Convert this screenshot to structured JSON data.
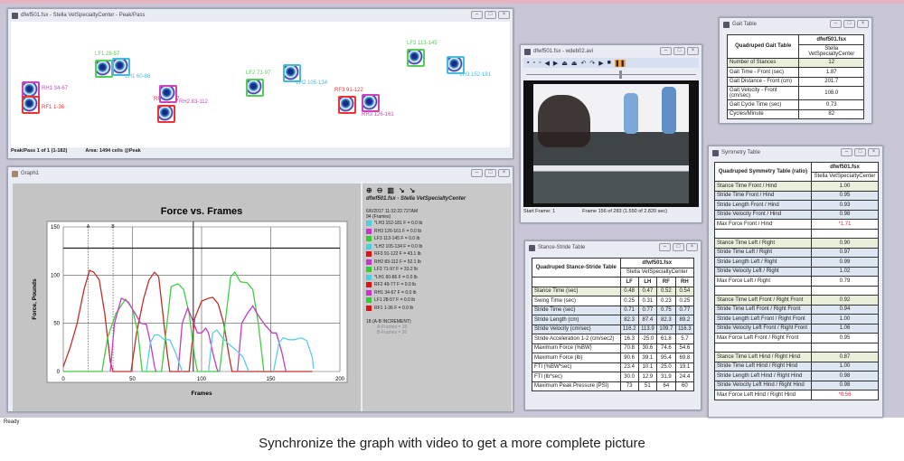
{
  "peakpass": {
    "title": "dfwf501.fsx - Stella  VetSpecialtyCenter - Peak/Pass",
    "status_left": "Peak/Pass 1 of 1 (1-182)",
    "status_right": "Area: 1494 cells @Peak",
    "footprints": [
      {
        "label": "RH1 34-67",
        "color": "#cc44bb"
      },
      {
        "label": "RF1 1-36",
        "color": "#e33"
      },
      {
        "label": "LF1 28-57",
        "color": "#5c5"
      },
      {
        "label": "*LH1 60-86",
        "color": "#4bd"
      },
      {
        "label": "RF2 49-77",
        "color": "#e33"
      },
      {
        "label": "RH2 83-112",
        "color": "#cc44bb"
      },
      {
        "label": "LF2 71-97",
        "color": "#5c5"
      },
      {
        "label": "*LH2 105-134",
        "color": "#4bd"
      },
      {
        "label": "RF3 91-122",
        "color": "#e33"
      },
      {
        "label": "RH3 126-161",
        "color": "#cc44bb"
      },
      {
        "label": "LF3 113-145",
        "color": "#5c5"
      },
      {
        "label": "*LH3 152-181",
        "color": "#4bd"
      }
    ]
  },
  "graph": {
    "title": "Graph1",
    "file_title": "dfwf501.fsx - Stella  VetSpecialtyCenter",
    "timestamp": "6/6/2017 11:32:22.727AM",
    "frame_line": "94  (Frames)",
    "legend": [
      {
        "label": "*LH3 152-181 F = 0.0 lb",
        "color": "#4cd0e0"
      },
      {
        "label": "RH3 126-161 F = 0.0 lb",
        "color": "#cc33cc"
      },
      {
        "label": "LF3 113-145 F = 0.0 lb",
        "color": "#33cc33"
      },
      {
        "label": "*LH2 105-134 F = 0.0 lb",
        "color": "#4cd0e0"
      },
      {
        "label": "RF3 91-122 F = 43.1 lb",
        "color": "#dd1111"
      },
      {
        "label": "RH2 83-112 F = 52.1 lb",
        "color": "#cc33cc"
      },
      {
        "label": "LF2 71-97 F = 33.2 lb",
        "color": "#33cc33"
      },
      {
        "label": "*LH1 60-86 F = 0.0 lb",
        "color": "#4cd0e0"
      },
      {
        "label": "RF2 49-77 F = 0.0 lb",
        "color": "#dd1111"
      },
      {
        "label": "RH1 34-67 F = 0.0 lb",
        "color": "#cc33cc"
      },
      {
        "label": "LF1 28-57 F = 0.0 lb",
        "color": "#33cc33"
      },
      {
        "label": "RF1 1-36 F = 0.0 lb",
        "color": "#dd1111"
      }
    ],
    "increment": "18  (A-B INCREMENT)",
    "a_frames": "A-Frames = 18",
    "b_frames": "B-Frames = 36"
  },
  "chart_data": {
    "type": "line",
    "title": "Force vs. Frames",
    "xlabel": "Frames",
    "ylabel": "Force, Pounds",
    "xlim": [
      0,
      200
    ],
    "ylim": [
      0,
      150
    ],
    "xticks": [
      "0",
      "50",
      "100",
      "150",
      "200"
    ],
    "yticks": [
      "0",
      "50",
      "100",
      "150"
    ],
    "threshold": 128,
    "cursor_frame": 94,
    "cursor_a": 18,
    "cursor_b": 36,
    "cursor_labels": [
      "A",
      "B"
    ],
    "series": [
      {
        "name": "RF",
        "color": "#c0302a",
        "points": [
          [
            0,
            5
          ],
          [
            5,
            25
          ],
          [
            10,
            50
          ],
          [
            15,
            85
          ],
          [
            19,
            105
          ],
          [
            22,
            103
          ],
          [
            26,
            95
          ],
          [
            30,
            60
          ],
          [
            34,
            10
          ],
          [
            36,
            0
          ],
          [
            49,
            0
          ],
          [
            53,
            40
          ],
          [
            58,
            75
          ],
          [
            62,
            95
          ],
          [
            66,
            103
          ],
          [
            69,
            98
          ],
          [
            72,
            60
          ],
          [
            75,
            20
          ],
          [
            77,
            0
          ],
          [
            91,
            0
          ],
          [
            95,
            55
          ],
          [
            100,
            73
          ],
          [
            105,
            76
          ],
          [
            108,
            77
          ],
          [
            112,
            70
          ],
          [
            116,
            50
          ],
          [
            120,
            15
          ],
          [
            122,
            0
          ],
          [
            180,
            0
          ]
        ]
      },
      {
        "name": "LF",
        "color": "#44cc44",
        "points": [
          [
            0,
            0
          ],
          [
            28,
            0
          ],
          [
            32,
            35
          ],
          [
            38,
            60
          ],
          [
            45,
            75
          ],
          [
            50,
            65
          ],
          [
            54,
            40
          ],
          [
            57,
            0
          ],
          [
            71,
            0
          ],
          [
            75,
            50
          ],
          [
            78,
            88
          ],
          [
            83,
            91
          ],
          [
            87,
            85
          ],
          [
            91,
            60
          ],
          [
            95,
            15
          ],
          [
            97,
            0
          ],
          [
            113,
            0
          ],
          [
            117,
            50
          ],
          [
            121,
            98
          ],
          [
            124,
            103
          ],
          [
            128,
            93
          ],
          [
            133,
            92
          ],
          [
            137,
            85
          ],
          [
            141,
            50
          ],
          [
            145,
            0
          ]
        ]
      },
      {
        "name": "RH",
        "color": "#c43cc4",
        "points": [
          [
            34,
            0
          ],
          [
            37,
            50
          ],
          [
            42,
            76
          ],
          [
            47,
            72
          ],
          [
            52,
            60
          ],
          [
            56,
            50
          ],
          [
            60,
            49
          ],
          [
            63,
            30
          ],
          [
            66,
            5
          ],
          [
            67,
            0
          ]
        ]
      },
      {
        "name": "RH2",
        "color": "#c43cc4",
        "points": [
          [
            83,
            0
          ],
          [
            86,
            50
          ],
          [
            90,
            66
          ],
          [
            93,
            55
          ],
          [
            97,
            40
          ],
          [
            100,
            40
          ],
          [
            103,
            45
          ],
          [
            105,
            40
          ],
          [
            108,
            20
          ],
          [
            111,
            3
          ],
          [
            112,
            0
          ]
        ]
      },
      {
        "name": "RH3",
        "color": "#c43cc4",
        "points": [
          [
            126,
            0
          ],
          [
            129,
            50
          ],
          [
            133,
            60
          ],
          [
            137,
            68
          ],
          [
            141,
            58
          ],
          [
            146,
            48
          ],
          [
            151,
            40
          ],
          [
            154,
            40
          ],
          [
            158,
            20
          ],
          [
            161,
            0
          ]
        ]
      },
      {
        "name": "LH1",
        "color": "#5cd0e0",
        "points": [
          [
            60,
            0
          ],
          [
            63,
            30
          ],
          [
            66,
            38
          ],
          [
            69,
            38
          ],
          [
            73,
            33
          ],
          [
            77,
            33
          ],
          [
            81,
            20
          ],
          [
            86,
            0
          ]
        ]
      },
      {
        "name": "LH2",
        "color": "#5cd0e0",
        "points": [
          [
            105,
            0
          ],
          [
            108,
            40
          ],
          [
            111,
            43
          ],
          [
            115,
            35
          ],
          [
            120,
            28
          ],
          [
            125,
            22
          ],
          [
            130,
            15
          ],
          [
            134,
            0
          ]
        ]
      },
      {
        "name": "LH3",
        "color": "#5cd0e0",
        "points": [
          [
            152,
            0
          ],
          [
            156,
            30
          ],
          [
            159,
            35
          ],
          [
            163,
            33
          ],
          [
            167,
            33
          ],
          [
            172,
            35
          ],
          [
            176,
            32
          ],
          [
            180,
            15
          ],
          [
            181,
            3
          ]
        ]
      }
    ]
  },
  "video": {
    "title": "dfwf501.fsx - wdeb02.avi",
    "start_frame": "Start Frame: 1",
    "frame_info": "Frame 156 of 283  (1.550 of 2.820 sec)",
    "slider_fraction": 0.55
  },
  "gait": {
    "title": "Gait Table",
    "header": "Quadruped Gait Table",
    "file": "dfwf501.fsx",
    "subject": "Stella VetSpecialtyCenter",
    "rows": [
      [
        "Number of Stances",
        "12"
      ],
      [
        "Gait Time - Front (sec)",
        "1.87"
      ],
      [
        "Gait Distance - Front (cm)",
        "201.7"
      ],
      [
        "Gait Velocity - Front (cm/sec)",
        "108.0"
      ],
      [
        "Gait Cycle Time (sec)",
        "0.73"
      ],
      [
        "Cycles/Minute",
        "82"
      ]
    ]
  },
  "stance": {
    "title": "Stance-Stride Table",
    "header": "Quadruped Stance-Stride Table",
    "file": "dfwf501.fsx",
    "subject": "Stella VetSpecialtyCenter",
    "cols": [
      "LF",
      "LH",
      "RF",
      "RH"
    ],
    "rows": [
      [
        "Stance Time (sec)",
        "0.48",
        "0.47",
        "0.52",
        "0.54"
      ],
      [
        "Swing Time (sec)",
        "0.25",
        "0.31",
        "0.23",
        "0.25"
      ],
      [
        "Stride Time (sec)",
        "0.71",
        "0.77",
        "0.75",
        "0.77"
      ],
      [
        "Stride Length (cm)",
        "82.3",
        "87.4",
        "82.3",
        "89.2"
      ],
      [
        "Stride Velocity (cm/sec)",
        "116.2",
        "113.9",
        "109.7",
        "116.3"
      ],
      [
        "Stride Acceleration 1-2 (cm/sec2)",
        "16.3",
        "-25.0",
        "61.8",
        "5.7"
      ],
      [
        "Maximum Force (%BW)",
        "70.8",
        "30.6",
        "74.6",
        "54.6"
      ],
      [
        "Maximum Force (lb)",
        "90.6",
        "39.1",
        "95.4",
        "69.8"
      ],
      [
        "FTI (%BW*sec)",
        "23.4",
        "10.1",
        "25.0",
        "19.1"
      ],
      [
        "FTI (lb*sec)",
        "30.0",
        "12.9",
        "31.9",
        "24.4"
      ],
      [
        "Maximum Peak Pressure (PSI)",
        "73",
        "51",
        "64",
        "60"
      ]
    ]
  },
  "symmetry": {
    "title": "Symmetry Table",
    "header": "Quadruped Symmetry Table (ratio)",
    "file": "dfwf501.fsx",
    "subject": "Stella VetSpecialtyCenter",
    "rows": [
      [
        "Stance Time Front / Hind",
        "1.00"
      ],
      [
        "Stride Time Front / Hind",
        "0.95"
      ],
      [
        "Stride Length Front / Hind",
        "0.93"
      ],
      [
        "Stride Velocity Front / Hind",
        "0.98"
      ],
      [
        "Max Force Front / Hind",
        "*1.71"
      ],
      [
        "",
        ""
      ],
      [
        "Stance Time Left / Right",
        "0.90"
      ],
      [
        "Stride Time Left / Right",
        "0.97"
      ],
      [
        "Stride Length Left / Right",
        "0.99"
      ],
      [
        "Stride Velocity Left / Right",
        "1.02"
      ],
      [
        "Max Force Left / Right",
        "0.79"
      ],
      [
        "",
        ""
      ],
      [
        "Stance Time Left Front / Right Front",
        "0.92"
      ],
      [
        "Stride Time Left Front / Right Front",
        "0.94"
      ],
      [
        "Stride Length Left Front / Right Front",
        "1.00"
      ],
      [
        "Stride Velocity Left Front / Right Front",
        "1.06"
      ],
      [
        "Max Force Left Front / Right Front",
        "0.95"
      ],
      [
        "",
        ""
      ],
      [
        "Stance Time Left Hind / Right Hind",
        "0.87"
      ],
      [
        "Stride Time Left Hind / Right Hind",
        "1.00"
      ],
      [
        "Stride Length Left Hind / Right Hind",
        "0.98"
      ],
      [
        "Stride Velocity Left Hind / Right Hind",
        "0.98"
      ],
      [
        "Max Force Left Hind / Right Hind",
        "*0.56"
      ]
    ]
  },
  "app_status": "Ready",
  "caption": "Synchronize the graph with video to get a more complete picture"
}
